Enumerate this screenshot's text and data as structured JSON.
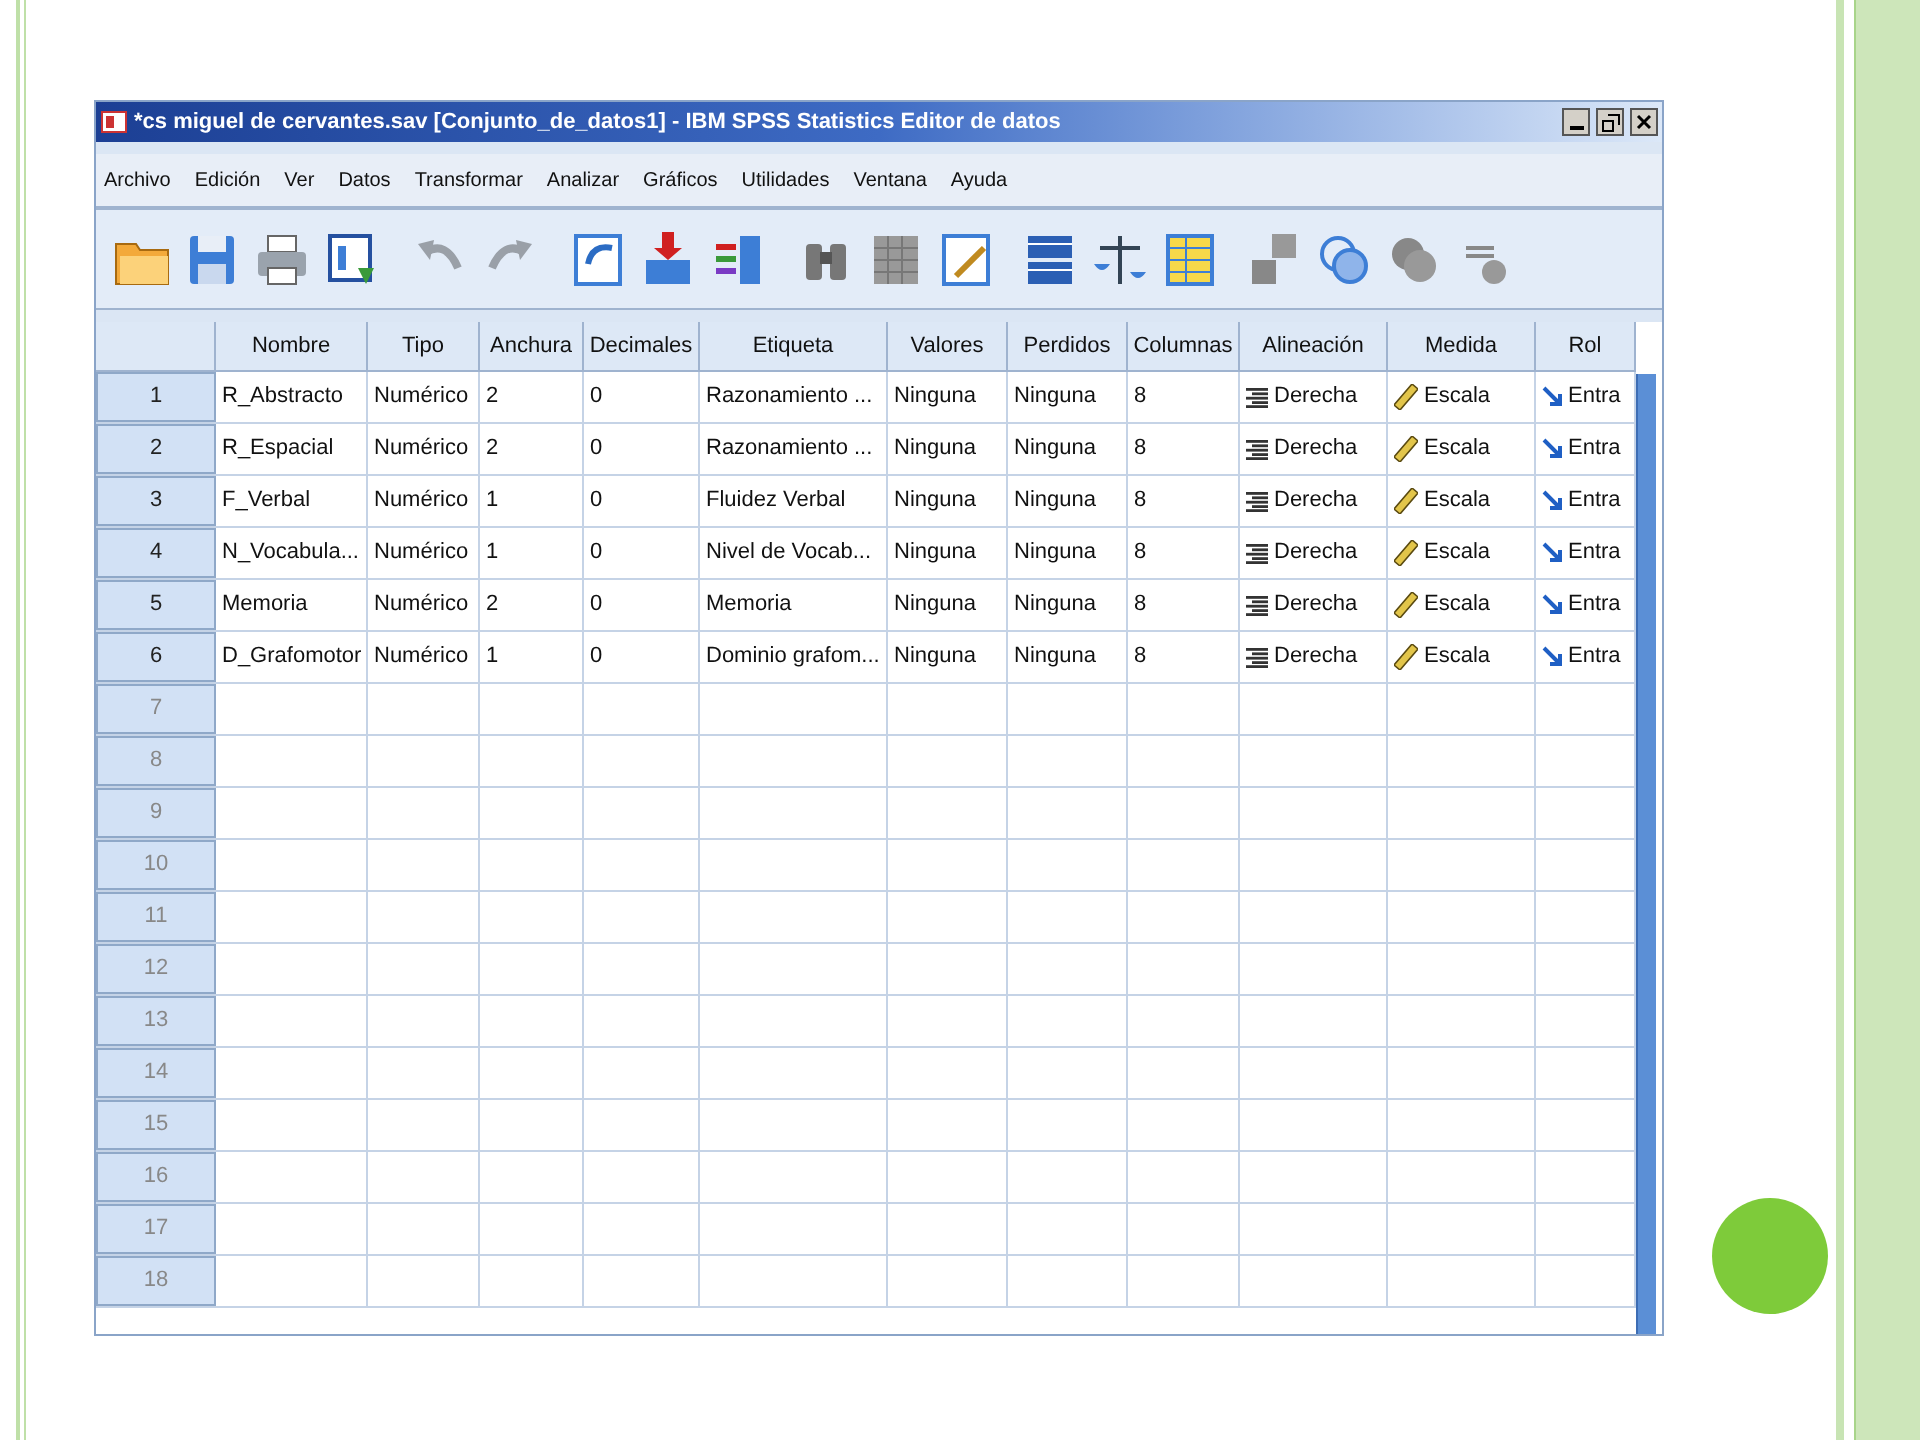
{
  "window": {
    "title": "*cs miguel de cervantes.sav [Conjunto_de_datos1] - IBM SPSS Statistics Editor de datos"
  },
  "menu": [
    "Archivo",
    "Edición",
    "Ver",
    "Datos",
    "Transformar",
    "Analizar",
    "Gráficos",
    "Utilidades",
    "Ventana",
    "Ayuda"
  ],
  "table": {
    "columns": [
      {
        "label": "Nombre",
        "kind": "text"
      },
      {
        "label": "Tipo",
        "kind": "text"
      },
      {
        "label": "Anchura",
        "kind": "text"
      },
      {
        "label": "Decimales",
        "kind": "text"
      },
      {
        "label": "Etiqueta",
        "kind": "text"
      },
      {
        "label": "Valores",
        "kind": "text"
      },
      {
        "label": "Perdidos",
        "kind": "text"
      },
      {
        "label": "Columnas",
        "kind": "text"
      },
      {
        "label": "Alineación",
        "kind": "align"
      },
      {
        "label": "Medida",
        "kind": "measure"
      },
      {
        "label": "Rol",
        "kind": "role"
      }
    ],
    "rows": [
      {
        "number": "1",
        "cells": [
          "R_Abstracto",
          "Numérico",
          "2",
          "0",
          "Razonamiento ...",
          "Ninguna",
          "Ninguna",
          "8",
          "Derecha",
          "Escala",
          "Entra"
        ]
      },
      {
        "number": "2",
        "cells": [
          "R_Espacial",
          "Numérico",
          "2",
          "0",
          "Razonamiento ...",
          "Ninguna",
          "Ninguna",
          "8",
          "Derecha",
          "Escala",
          "Entra"
        ]
      },
      {
        "number": "3",
        "cells": [
          "F_Verbal",
          "Numérico",
          "1",
          "0",
          "Fluidez Verbal",
          "Ninguna",
          "Ninguna",
          "8",
          "Derecha",
          "Escala",
          "Entra"
        ]
      },
      {
        "number": "4",
        "cells": [
          "N_Vocabula...",
          "Numérico",
          "1",
          "0",
          "Nivel de Vocab...",
          "Ninguna",
          "Ninguna",
          "8",
          "Derecha",
          "Escala",
          "Entra"
        ]
      },
      {
        "number": "5",
        "cells": [
          "Memoria",
          "Numérico",
          "2",
          "0",
          "Memoria",
          "Ninguna",
          "Ninguna",
          "8",
          "Derecha",
          "Escala",
          "Entra"
        ]
      },
      {
        "number": "6",
        "cells": [
          "D_Grafomotor",
          "Numérico",
          "1",
          "0",
          "Dominio grafom...",
          "Ninguna",
          "Ninguna",
          "8",
          "Derecha",
          "Escala",
          "Entra"
        ]
      },
      {
        "number": "7"
      },
      {
        "number": "8"
      },
      {
        "number": "9"
      },
      {
        "number": "10"
      },
      {
        "number": "11"
      },
      {
        "number": "12"
      },
      {
        "number": "13"
      },
      {
        "number": "14"
      },
      {
        "number": "15"
      },
      {
        "number": "16"
      },
      {
        "number": "17"
      },
      {
        "number": "18"
      }
    ]
  }
}
